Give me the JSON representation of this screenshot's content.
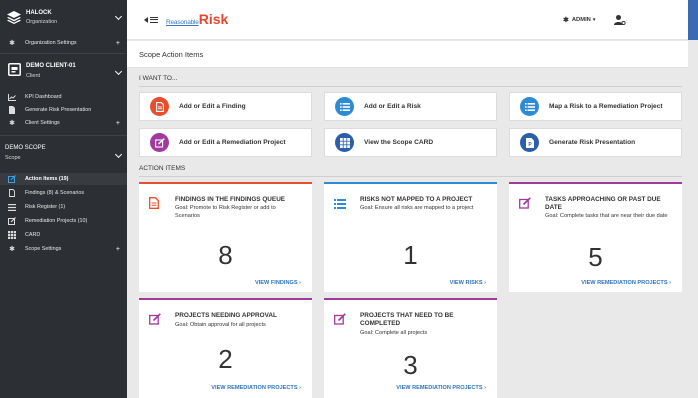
{
  "sidebar": {
    "org": {
      "name": "HALOCK",
      "sub": "Organization"
    },
    "org_settings": "Organization Settings",
    "client": {
      "name": "DEMO CLIENT-01",
      "sub": "Client"
    },
    "client_items": [
      {
        "label": "KPI Dashboard",
        "icon": "chart-icon"
      },
      {
        "label": "Generate Risk Presentation",
        "icon": "file-icon"
      },
      {
        "label": "Client Settings",
        "icon": "gear-icon"
      }
    ],
    "scope": {
      "name": "DEMO SCOPE",
      "sub": "Scope"
    },
    "scope_items": [
      {
        "label": "Action Items (19)",
        "icon": "pencil-icon"
      },
      {
        "label": "Findings (8) & Scenarios",
        "icon": "document-icon"
      },
      {
        "label": "Risk Register (1)",
        "icon": "list-icon"
      },
      {
        "label": "Remediation Projects (10)",
        "icon": "edit-icon"
      },
      {
        "label": "CARD",
        "icon": "grid-icon"
      },
      {
        "label": "Scope Settings",
        "icon": "gear-icon"
      }
    ]
  },
  "topbar": {
    "logo_small": "Reasonable",
    "logo_big": "Risk",
    "admin_label": "ADMIN"
  },
  "page": {
    "title": "Scope Action Items",
    "i_want_to": "I WANT TO...",
    "action_items_label": "ACTION ITEMS"
  },
  "actions": [
    {
      "label": "Add or Edit a Finding",
      "color": "#e94e2c",
      "icon": "document-icon"
    },
    {
      "label": "Add or Edit a Risk",
      "color": "#2f8ad4",
      "icon": "list-icon"
    },
    {
      "label": "Map a Risk to a Remediation Project",
      "color": "#2f8ad4",
      "icon": "list-icon"
    },
    {
      "label": "Add or Edit a Remediation Project",
      "color": "#a23a9e",
      "icon": "edit-icon"
    },
    {
      "label": "View the Scope CARD",
      "color": "#2b5fa8",
      "icon": "grid-icon"
    },
    {
      "label": "Generate Risk Presentation",
      "color": "#2b5fa8",
      "icon": "file-icon"
    }
  ],
  "cards": [
    {
      "title": "Findings in the Findings Queue",
      "goal": "Goal: Promote to Risk Register or add to Scenarios",
      "count": "8",
      "link": "View Findings ›",
      "color": "#e94e2c",
      "icon": "document-icon"
    },
    {
      "title": "Risks not mapped to a project",
      "goal": "Goal: Ensure all risks are mapped to a project",
      "count": "1",
      "link": "View Risks ›",
      "color": "#2f8ad4",
      "icon": "list-icon"
    },
    {
      "title": "Tasks approaching or past due date",
      "goal": "Goal: Complete tasks that are near their due date",
      "count": "5",
      "link": "View Remediation Projects ›",
      "color": "#a23a9e",
      "icon": "edit-icon"
    },
    {
      "title": "Projects needing approval",
      "goal": "Goal: Obtain approval for all projects",
      "count": "2",
      "link": "View Remediation Projects ›",
      "color": "#a23a9e",
      "icon": "edit-icon"
    },
    {
      "title": "Projects that need to be completed",
      "goal": "Goal: Complete all projects",
      "count": "3",
      "link": "View Remediation Projects ›",
      "color": "#a23a9e",
      "icon": "edit-icon"
    }
  ]
}
